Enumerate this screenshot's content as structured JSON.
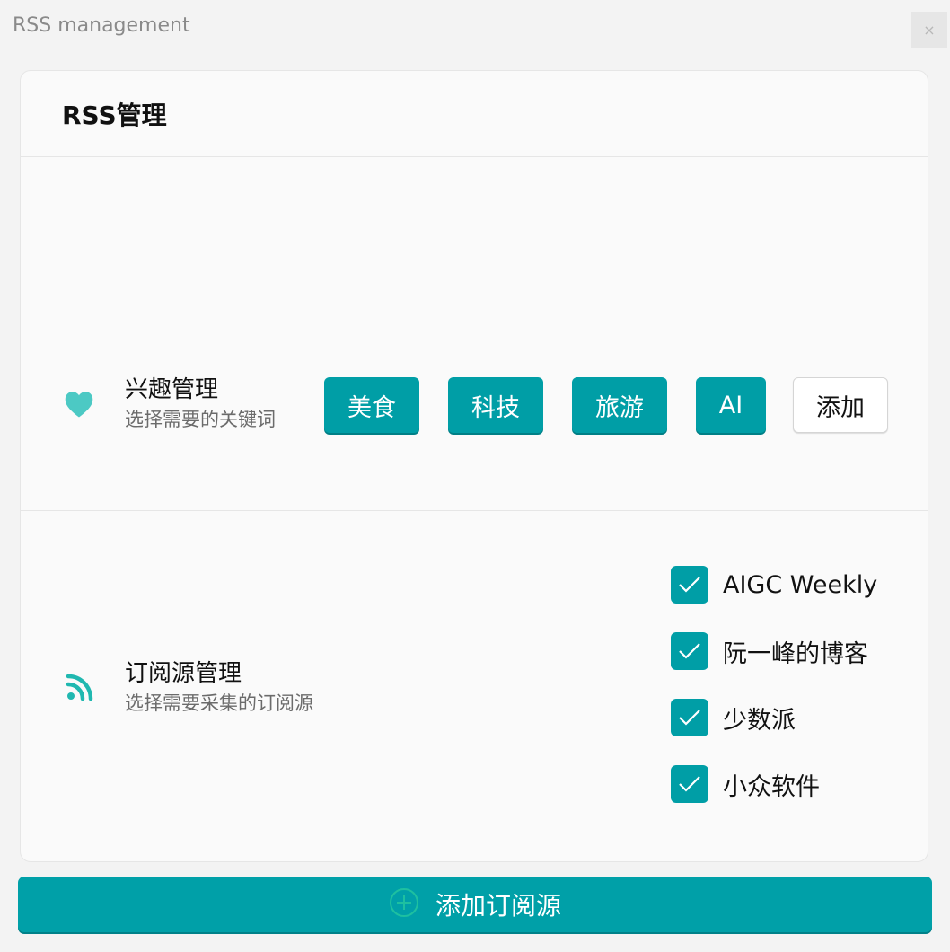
{
  "window": {
    "title": "RSS management",
    "close_label": "×"
  },
  "card": {
    "title": "RSS管理"
  },
  "interest": {
    "icon": "heart-icon",
    "title": "兴趣管理",
    "subtitle": "选择需要的关键词",
    "tags": [
      "美食",
      "科技",
      "旅游",
      "AI"
    ],
    "add_label": "添加"
  },
  "feeds": {
    "icon": "rss-icon",
    "title": "订阅源管理",
    "subtitle": "选择需要采集的订阅源",
    "items": [
      {
        "label": "AIGC Weekly",
        "checked": true
      },
      {
        "label": "阮一峰的博客",
        "checked": true
      },
      {
        "label": "少数派",
        "checked": true
      },
      {
        "label": "小众软件",
        "checked": true
      }
    ]
  },
  "footer": {
    "add_feed_label": "添加订阅源",
    "icon": "plus-circle-icon"
  },
  "colors": {
    "accent": "#009ea6",
    "icon_teal": "#4cc9c4",
    "background": "#f3f3f3"
  }
}
